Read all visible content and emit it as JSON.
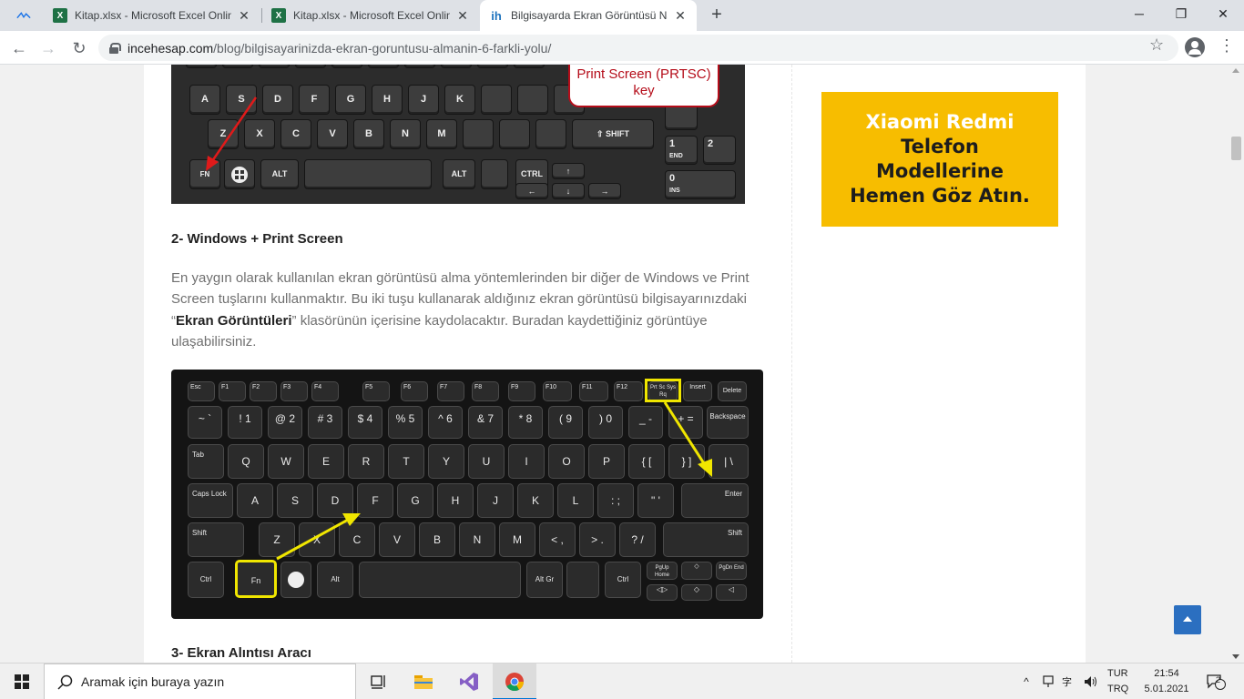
{
  "browser": {
    "tabs": [
      {
        "title": "Kitap.xlsx - Microsoft Excel Online",
        "icon": "excel-icon",
        "close": "✕"
      },
      {
        "title": "Kitap.xlsx - Microsoft Excel Online",
        "icon": "excel-icon",
        "close": "✕"
      },
      {
        "title": "Bilgisayarda Ekran Görüntüsü Nasıl Alınır",
        "icon": "incehesap-icon",
        "close": "✕",
        "active": true
      }
    ],
    "new_tab": "+",
    "window_controls": {
      "minimize": "─",
      "restore": "❐",
      "close": "✕"
    },
    "url_host": "incehesap.com",
    "url_path": "/blog/bilgisayarinizda-ekran-goruntusu-almanin-6-farkli-yolu/"
  },
  "article": {
    "callout": "Print Screen (PRTSC) key",
    "heading2": "2- Windows + Print Screen",
    "paragraph_1": "En yaygın olarak kullanılan ekran görüntüsü alma yöntemlerinden bir diğer de Windows ve Print Screen tuşlarını kullanmaktır. Bu iki tuşu kullanarak aldığınız ekran görüntüsü bilgisayarınızdaki “",
    "paragraph_bold": "Ekran Görüntüleri",
    "paragraph_2": "” klasörünün içerisine kaydolacaktır. Buradan kaydettiğiniz görüntüye ulaşabilirsiniz.",
    "heading3": "3- Ekran Alıntısı Aracı"
  },
  "keyboard_top": {
    "row1": [
      "A",
      "S",
      "D",
      "F",
      "G",
      "H",
      "J",
      "K"
    ],
    "row2": [
      "Z",
      "X",
      "C",
      "V",
      "B",
      "N",
      "M"
    ],
    "shift": "⇧ SHIFT",
    "fn": "FN",
    "alt": "ALT",
    "alt2": "ALT",
    "ctrl": "CTRL",
    "num_1": "1",
    "num_1_sub": "END",
    "num_2": "2",
    "num_0": "0",
    "num_0_sub": "INS"
  },
  "keyboard_bottom": {
    "row0": [
      "Esc",
      "F1",
      "F2",
      "F3",
      "F4",
      "F5",
      "F6",
      "F7",
      "F8",
      "F9",
      "F10",
      "F11",
      "F12"
    ],
    "prtsc": "Prt Sc Sys Rq",
    "insert": "Insert",
    "delete": "Delete",
    "row1": [
      "~ `",
      "! 1",
      "@ 2",
      "# 3",
      "$ 4",
      "% 5",
      "^ 6",
      "& 7",
      "* 8",
      "( 9",
      ") 0",
      "_ -",
      "+ ="
    ],
    "backspace": "Backspace",
    "tab": "Tab",
    "row2": [
      "Q",
      "W",
      "E",
      "R",
      "T",
      "Y",
      "U",
      "I",
      "O",
      "P",
      "{ [",
      "} ]",
      "| \\"
    ],
    "caps": "Caps Lock",
    "row3": [
      "A",
      "S",
      "D",
      "F",
      "G",
      "H",
      "J",
      "K",
      "L",
      ": ;",
      "\" '"
    ],
    "enter": "Enter",
    "shift_l": "Shift",
    "row4": [
      "Z",
      "X",
      "C",
      "V",
      "B",
      "N",
      "M",
      "< ,",
      "> .",
      "? /"
    ],
    "shift_r": "Shift",
    "ctrl": "Ctrl",
    "fn": "Fn",
    "alt": "Alt",
    "altgr": "Alt Gr",
    "ctrl_r": "Ctrl",
    "pgup": "PgUp Home",
    "pgdn": "PgDn End"
  },
  "sidebar_ad": {
    "line1": "Xiaomi Redmi",
    "line2": "Telefon Modellerine Hemen Göz Atın."
  },
  "taskbar": {
    "search_placeholder": "Aramak için buraya yazın",
    "lang_1": "TUR",
    "lang_2": "TRQ",
    "time": "21:54",
    "date": "5.01.2021",
    "notifications": "2"
  },
  "colors": {
    "accent_blue": "#2b6fc0",
    "ad_yellow": "#f7bd00",
    "callout_red": "#b50d1a",
    "highlight_yellow": "#f0e600"
  }
}
